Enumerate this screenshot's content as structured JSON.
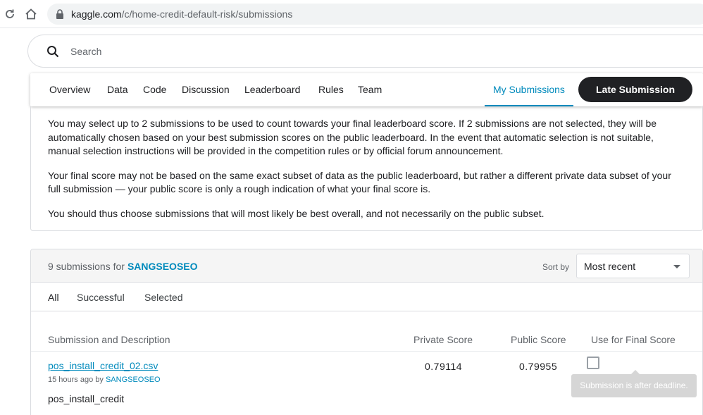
{
  "browser": {
    "url_domain": "kaggle.com",
    "url_path": "/c/home-credit-default-risk/submissions"
  },
  "search": {
    "placeholder": "Search"
  },
  "nav": {
    "tabs": [
      "Overview",
      "Data",
      "Code",
      "Discussion",
      "Leaderboard",
      "Rules",
      "Team"
    ],
    "my_submissions": "My Submissions",
    "late_submission": "Late Submission"
  },
  "info": {
    "p1": "You may select up to 2 submissions to be used to count towards your final leaderboard score. If 2 submissions are not selected, they will be automatically chosen based on your best submission scores on the public leaderboard. In the event that automatic selection is not suitable, manual selection instructions will be provided in the competition rules or by official forum announcement.",
    "p2": "Your final score may not be based on the same exact subset of data as the public leaderboard, but rather a different private data subset of your full submission — your public score is only a rough indication of what your final score is.",
    "p3": "You should thus choose submissions that will most likely be best overall, and not necessarily on the public subset."
  },
  "submissions": {
    "count_text": "9 submissions for",
    "user": "SANGSEOSEO",
    "sort_label": "Sort by",
    "sort_value": "Most recent",
    "filters": [
      "All",
      "Successful",
      "Selected"
    ],
    "columns": {
      "description": "Submission and Description",
      "private": "Private Score",
      "public": "Public Score",
      "final": "Use for Final Score"
    },
    "rows": [
      {
        "file": "pos_install_credit_02.csv",
        "time": "15 hours ago by",
        "user": "SANGSEOSEO",
        "description": "pos_install_credit",
        "private_score": "0.79114",
        "public_score": "0.79955"
      }
    ],
    "tooltip": "Submission is after deadline."
  },
  "colors": {
    "accent": "#008abc",
    "button_dark": "#202124"
  }
}
